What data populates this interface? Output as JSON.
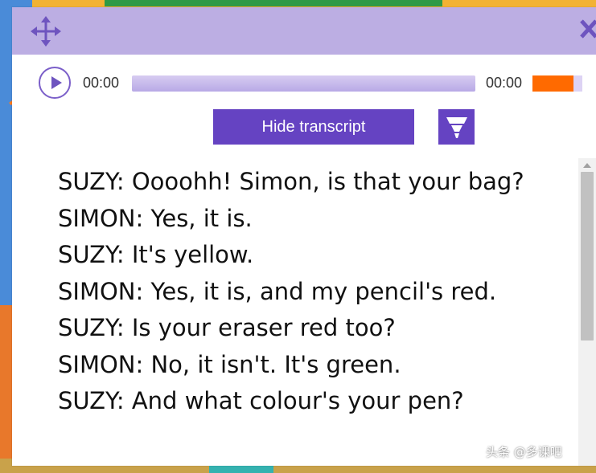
{
  "header": {
    "move_icon": "move-arrows-icon",
    "close_icon": "close-x-icon"
  },
  "player": {
    "play_icon": "play-icon",
    "current_time": "00:00",
    "total_time": "00:00",
    "progress_fraction": 0.0,
    "volume_fraction": 0.82,
    "accent_color": "#7b5fc9",
    "volume_color": "#ff6a00"
  },
  "controls": {
    "hide_transcript_label": "Hide transcript",
    "highlighter_icon": "highlighter-icon",
    "button_color": "#6543c2"
  },
  "transcript": {
    "lines": [
      "SUZY: Oooohh! Simon, is that your bag?",
      "SIMON: Yes, it is.",
      "SUZY: It's yellow.",
      "SIMON: Yes, it is, and my pencil's red.",
      "SUZY: Is your eraser red too?",
      "SIMON: No, it isn't. It's green.",
      "SUZY: And what colour's your pen?"
    ]
  },
  "watermark": {
    "text": "头条 @多课吧"
  },
  "colors": {
    "header_bg": "#bcaee3"
  }
}
